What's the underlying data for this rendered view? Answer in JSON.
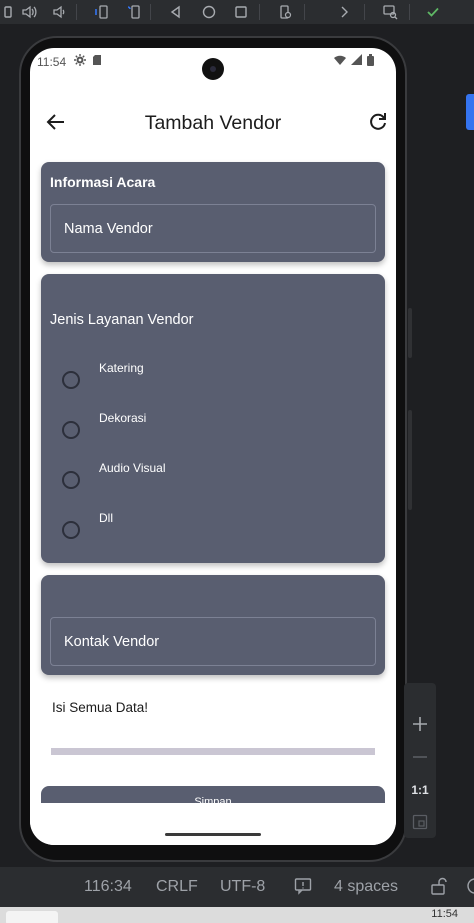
{
  "app": {
    "title": "Tambah Vendor"
  },
  "device_status": {
    "time": "11:54"
  },
  "cards": {
    "info": {
      "heading": "Informasi Acara",
      "field_label": "Nama Vendor"
    },
    "services": {
      "heading": "Jenis Layanan Vendor",
      "options": [
        "Katering",
        "Dekorasi",
        "Audio Visual",
        "Dll"
      ]
    },
    "contact": {
      "field_label": "Kontak Vendor"
    }
  },
  "note": "Isi Semua Data!",
  "save_label": "Simpan",
  "zoom": {
    "ratio_label": "1:1"
  },
  "ide_status": {
    "position": "116:34",
    "line_ending": "CRLF",
    "encoding": "UTF-8",
    "indent": "4 spaces"
  },
  "taskbar": {
    "clock": "11:54"
  },
  "colors": {
    "card": "#595e70",
    "accent": "#3574f0",
    "progress_track": "#cac6d3"
  }
}
